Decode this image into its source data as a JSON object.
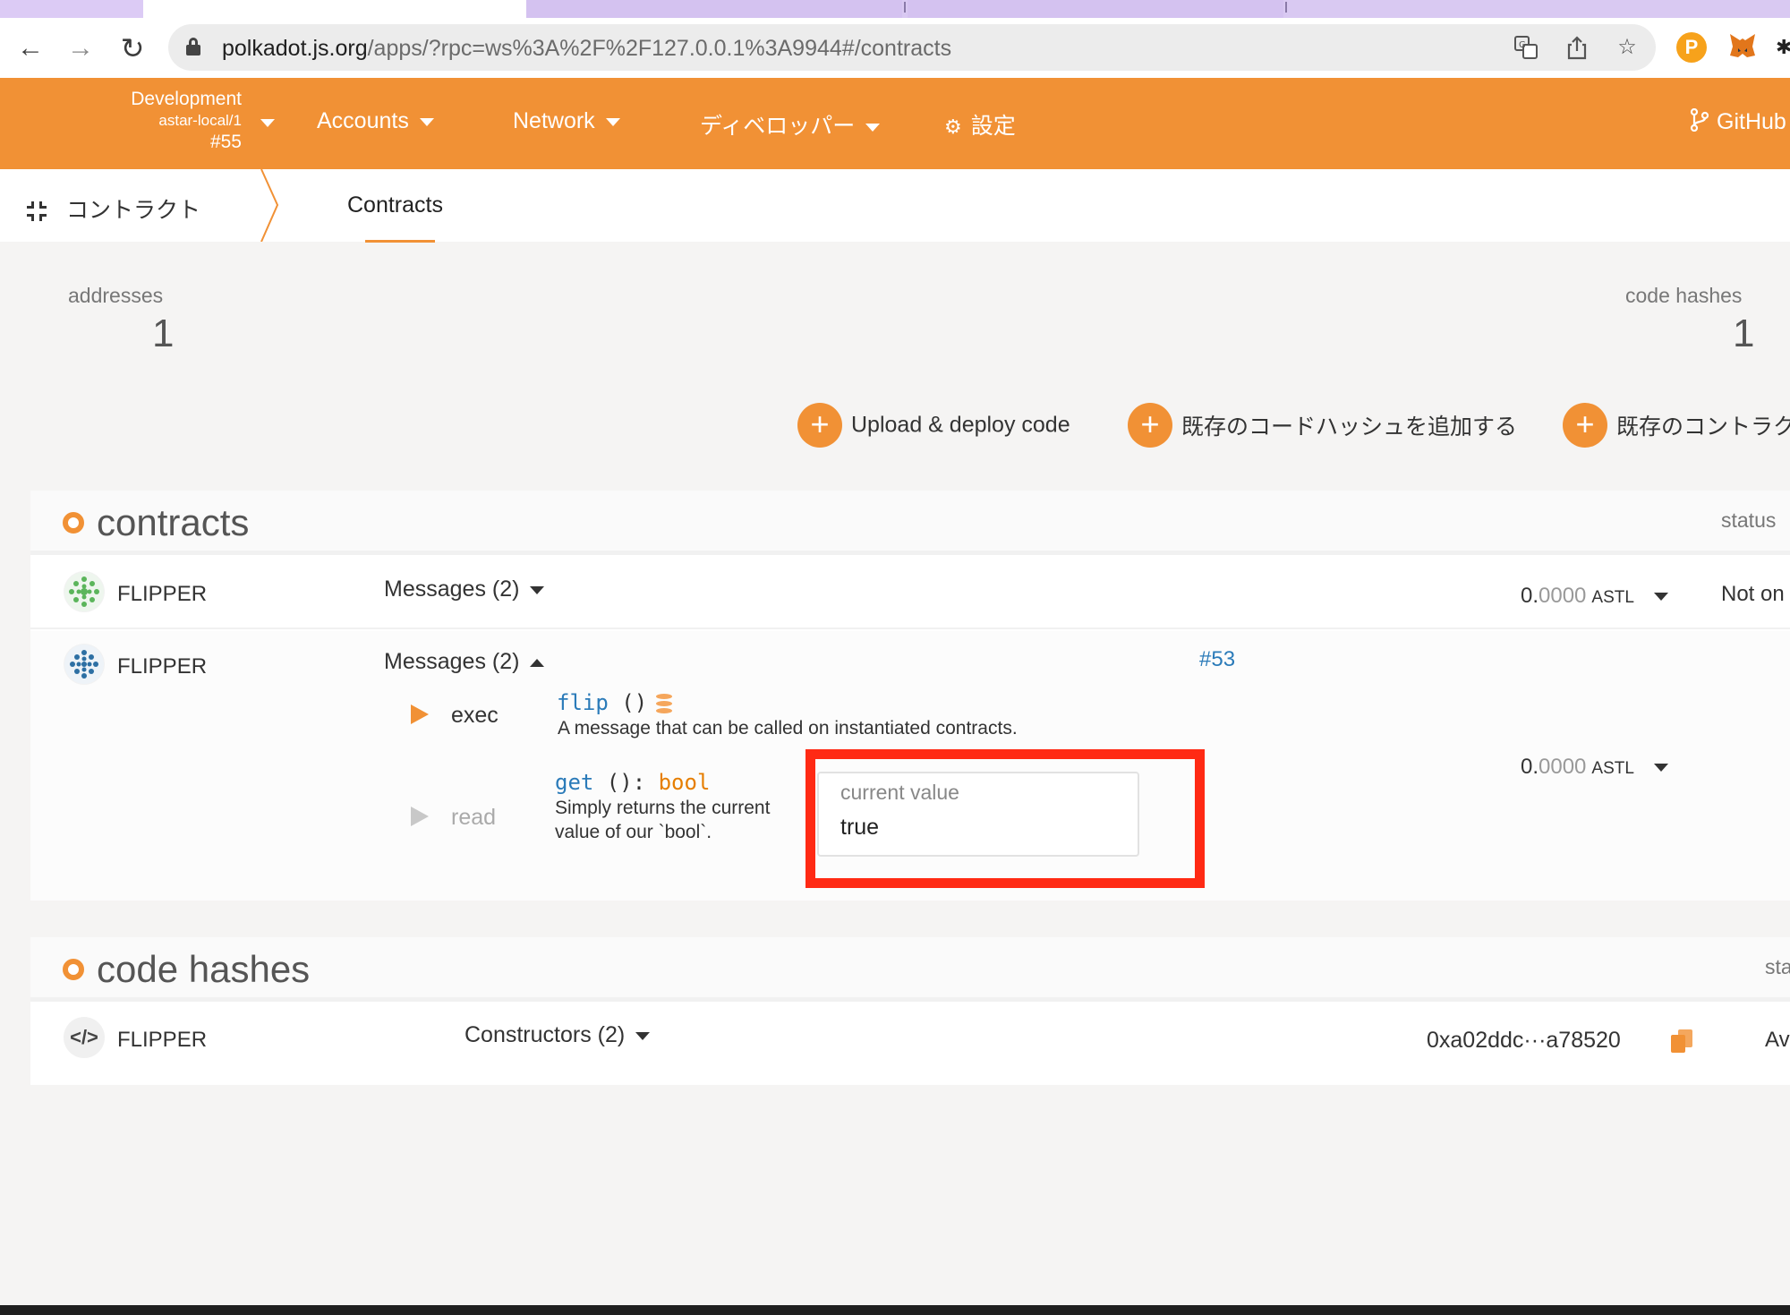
{
  "browser": {
    "url_host": "polkadot.js.org",
    "url_path": "/apps/?rpc=ws%3A%2F%2F127.0.0.1%3A9944#/contracts"
  },
  "header": {
    "chain_line1": "Development",
    "chain_line2": "astar-local/1",
    "chain_line3": "#55",
    "menu_accounts": "Accounts",
    "menu_network": "Network",
    "menu_developer": "ディベロッパー",
    "menu_settings": "設定",
    "github": "GitHub"
  },
  "subnav": {
    "section": "コントラクト",
    "tab": "Contracts"
  },
  "summary": {
    "addresses_label": "addresses",
    "addresses_value": "1",
    "code_hashes_label": "code hashes",
    "code_hashes_value": "1"
  },
  "actions": {
    "upload": "Upload & deploy code",
    "add_code_hash": "既存のコードハッシュを追加する",
    "add_contract": "既存のコントラク"
  },
  "contracts_table": {
    "title": "contracts",
    "status_header": "status",
    "rows": [
      {
        "name": "FLIPPER",
        "messages": "Messages (2)",
        "balance_int": "0.",
        "balance_frac": "0000",
        "unit": "ASTL",
        "status": "Not on"
      },
      {
        "name": "FLIPPER",
        "messages": "Messages (2)",
        "block": "#53",
        "balance_int": "0.",
        "balance_frac": "0000",
        "unit": "ASTL",
        "exec_label": "exec",
        "flip_name": "flip",
        "flip_sig": " ()",
        "flip_doc": "A message that can be called on instantiated contracts.",
        "read_label": "read",
        "get_name": "get",
        "get_sig": " (): ",
        "get_type": "bool",
        "get_doc1": "Simply returns the current",
        "get_doc2": "value of our `bool`.",
        "current_value_label": "current value",
        "current_value": "true"
      }
    ]
  },
  "code_hashes_table": {
    "title": "code hashes",
    "status_header": "sta",
    "rows": [
      {
        "name": "FLIPPER",
        "constructors": "Constructors (2)",
        "hash": "0xa02ddc···a78520",
        "status": "Av"
      }
    ]
  },
  "colors": {
    "accent": "#f19135",
    "highlight": "#ff2a14",
    "method_blue": "#2b7bb9"
  }
}
